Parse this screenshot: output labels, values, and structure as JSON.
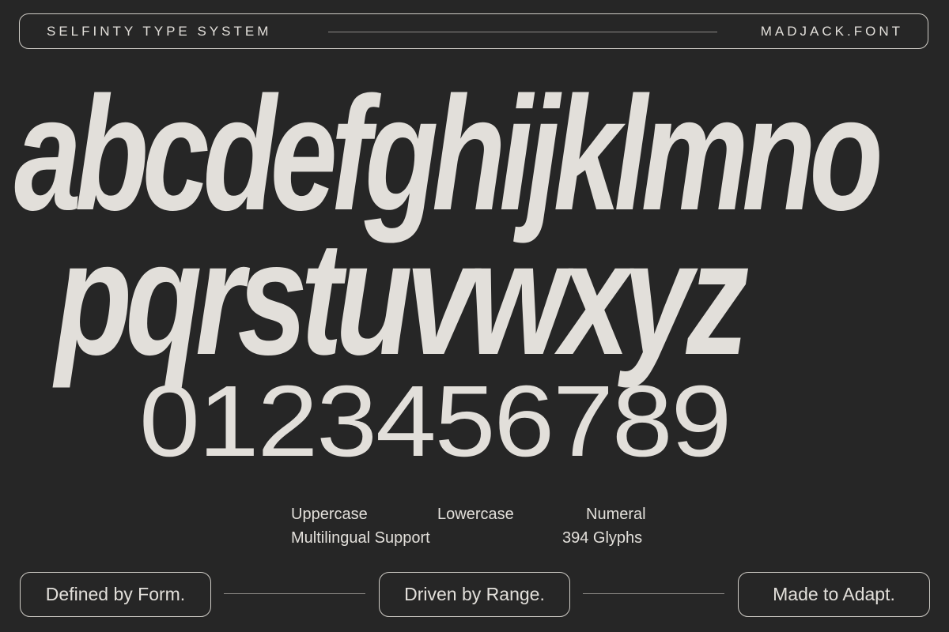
{
  "header": {
    "left_title": "SELFINTY TYPE SYSTEM",
    "right_title": "MADJACK.FONT"
  },
  "specimen": {
    "lowercase_row_1": "abcdefghijklmno",
    "lowercase_row_2": "pqrstuvwxyz",
    "numerals_row": "0123456789"
  },
  "features": {
    "uppercase": "Uppercase",
    "lowercase": "Lowercase",
    "numeral": "Numeral",
    "multilingual": "Multilingual Support",
    "glyphs": "394 Glyphs"
  },
  "footer": {
    "pill_1": "Defined by Form.",
    "pill_2": "Driven by Range.",
    "pill_3": "Made to Adapt."
  },
  "colors": {
    "background": "#262626",
    "foreground": "#e2dfda"
  }
}
